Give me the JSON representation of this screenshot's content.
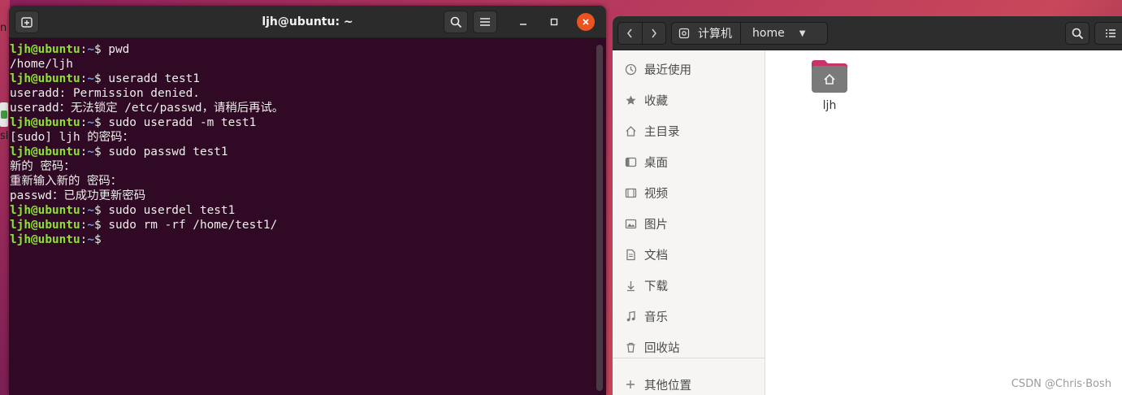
{
  "desktop": {
    "partial_chars": [
      "n",
      "sl"
    ]
  },
  "terminal": {
    "title": "ljh@ubuntu: ~",
    "prompt_user": "ljh@ubuntu",
    "prompt_path": "~",
    "lines": [
      {
        "type": "cmd",
        "cmd": "pwd"
      },
      {
        "type": "out",
        "text": "/home/ljh"
      },
      {
        "type": "cmd",
        "cmd": "useradd test1"
      },
      {
        "type": "out",
        "text": "useradd: Permission denied."
      },
      {
        "type": "out",
        "text": "useradd：无法锁定 /etc/passwd，请稍后再试。"
      },
      {
        "type": "cmd",
        "cmd": "sudo useradd -m test1"
      },
      {
        "type": "out",
        "text": "[sudo] ljh 的密码："
      },
      {
        "type": "cmd",
        "cmd": "sudo passwd test1"
      },
      {
        "type": "out",
        "text": "新的 密码："
      },
      {
        "type": "out",
        "text": "重新输入新的 密码："
      },
      {
        "type": "out",
        "text": "passwd：已成功更新密码"
      },
      {
        "type": "cmd",
        "cmd": "sudo userdel test1"
      },
      {
        "type": "cmd",
        "cmd": "sudo rm -rf /home/test1/"
      },
      {
        "type": "cmd",
        "cmd": ""
      }
    ],
    "icons": {
      "new_tab": "new-tab-icon",
      "search": "search-icon",
      "menu": "hamburger-menu-icon",
      "minimize": "minimize-icon",
      "maximize": "maximize-icon",
      "close": "close-icon"
    },
    "colors": {
      "background": "#300a24",
      "user": "#8ae234",
      "path": "#729fcf",
      "close": "#e95420"
    }
  },
  "files": {
    "breadcrumb": {
      "computer": "计算机",
      "home": "home"
    },
    "sidebar": [
      {
        "label": "最近使用",
        "icon": "recent-icon"
      },
      {
        "label": "收藏",
        "icon": "star-icon"
      },
      {
        "label": "主目录",
        "icon": "home-icon"
      },
      {
        "label": "桌面",
        "icon": "desktop-icon"
      },
      {
        "label": "视频",
        "icon": "video-icon"
      },
      {
        "label": "图片",
        "icon": "picture-icon"
      },
      {
        "label": "文档",
        "icon": "document-icon"
      },
      {
        "label": "下载",
        "icon": "download-icon"
      },
      {
        "label": "音乐",
        "icon": "music-icon"
      },
      {
        "label": "回收站",
        "icon": "trash-icon"
      }
    ],
    "other_locations": "其他位置",
    "folder": {
      "label": "ljh",
      "icon": "home-folder-icon"
    },
    "watermark": "CSDN @Chris·Bosh"
  }
}
